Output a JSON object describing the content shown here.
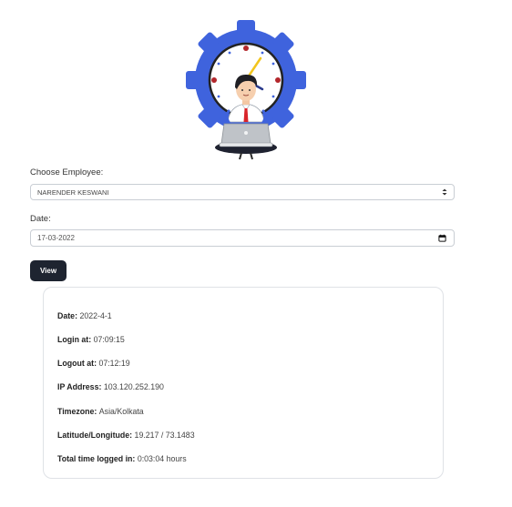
{
  "form": {
    "employee_label": "Choose Employee:",
    "employee_selected": "NARENDER KESWANI",
    "date_label": "Date:",
    "date_value": "17-03-2022",
    "view_button": "View"
  },
  "details": {
    "date_label": "Date:",
    "date_value": "2022-4-1",
    "login_label": "Login at:",
    "login_value": "07:09:15",
    "logout_label": "Logout at:",
    "logout_value": "07:12:19",
    "ip_label": "IP Address:",
    "ip_value": "103.120.252.190",
    "timezone_label": "Timezone:",
    "timezone_value": "Asia/Kolkata",
    "latlong_label": "Latitude/Longitude:",
    "latlong_value": "19.217 / 73.1483",
    "total_label": "Total time logged in:",
    "total_value": "0:03:04 hours"
  },
  "colors": {
    "gear": "#3f63dd",
    "button_bg": "#1e2430",
    "tie": "#d9252b",
    "clock_hand": "#f2c51d"
  }
}
